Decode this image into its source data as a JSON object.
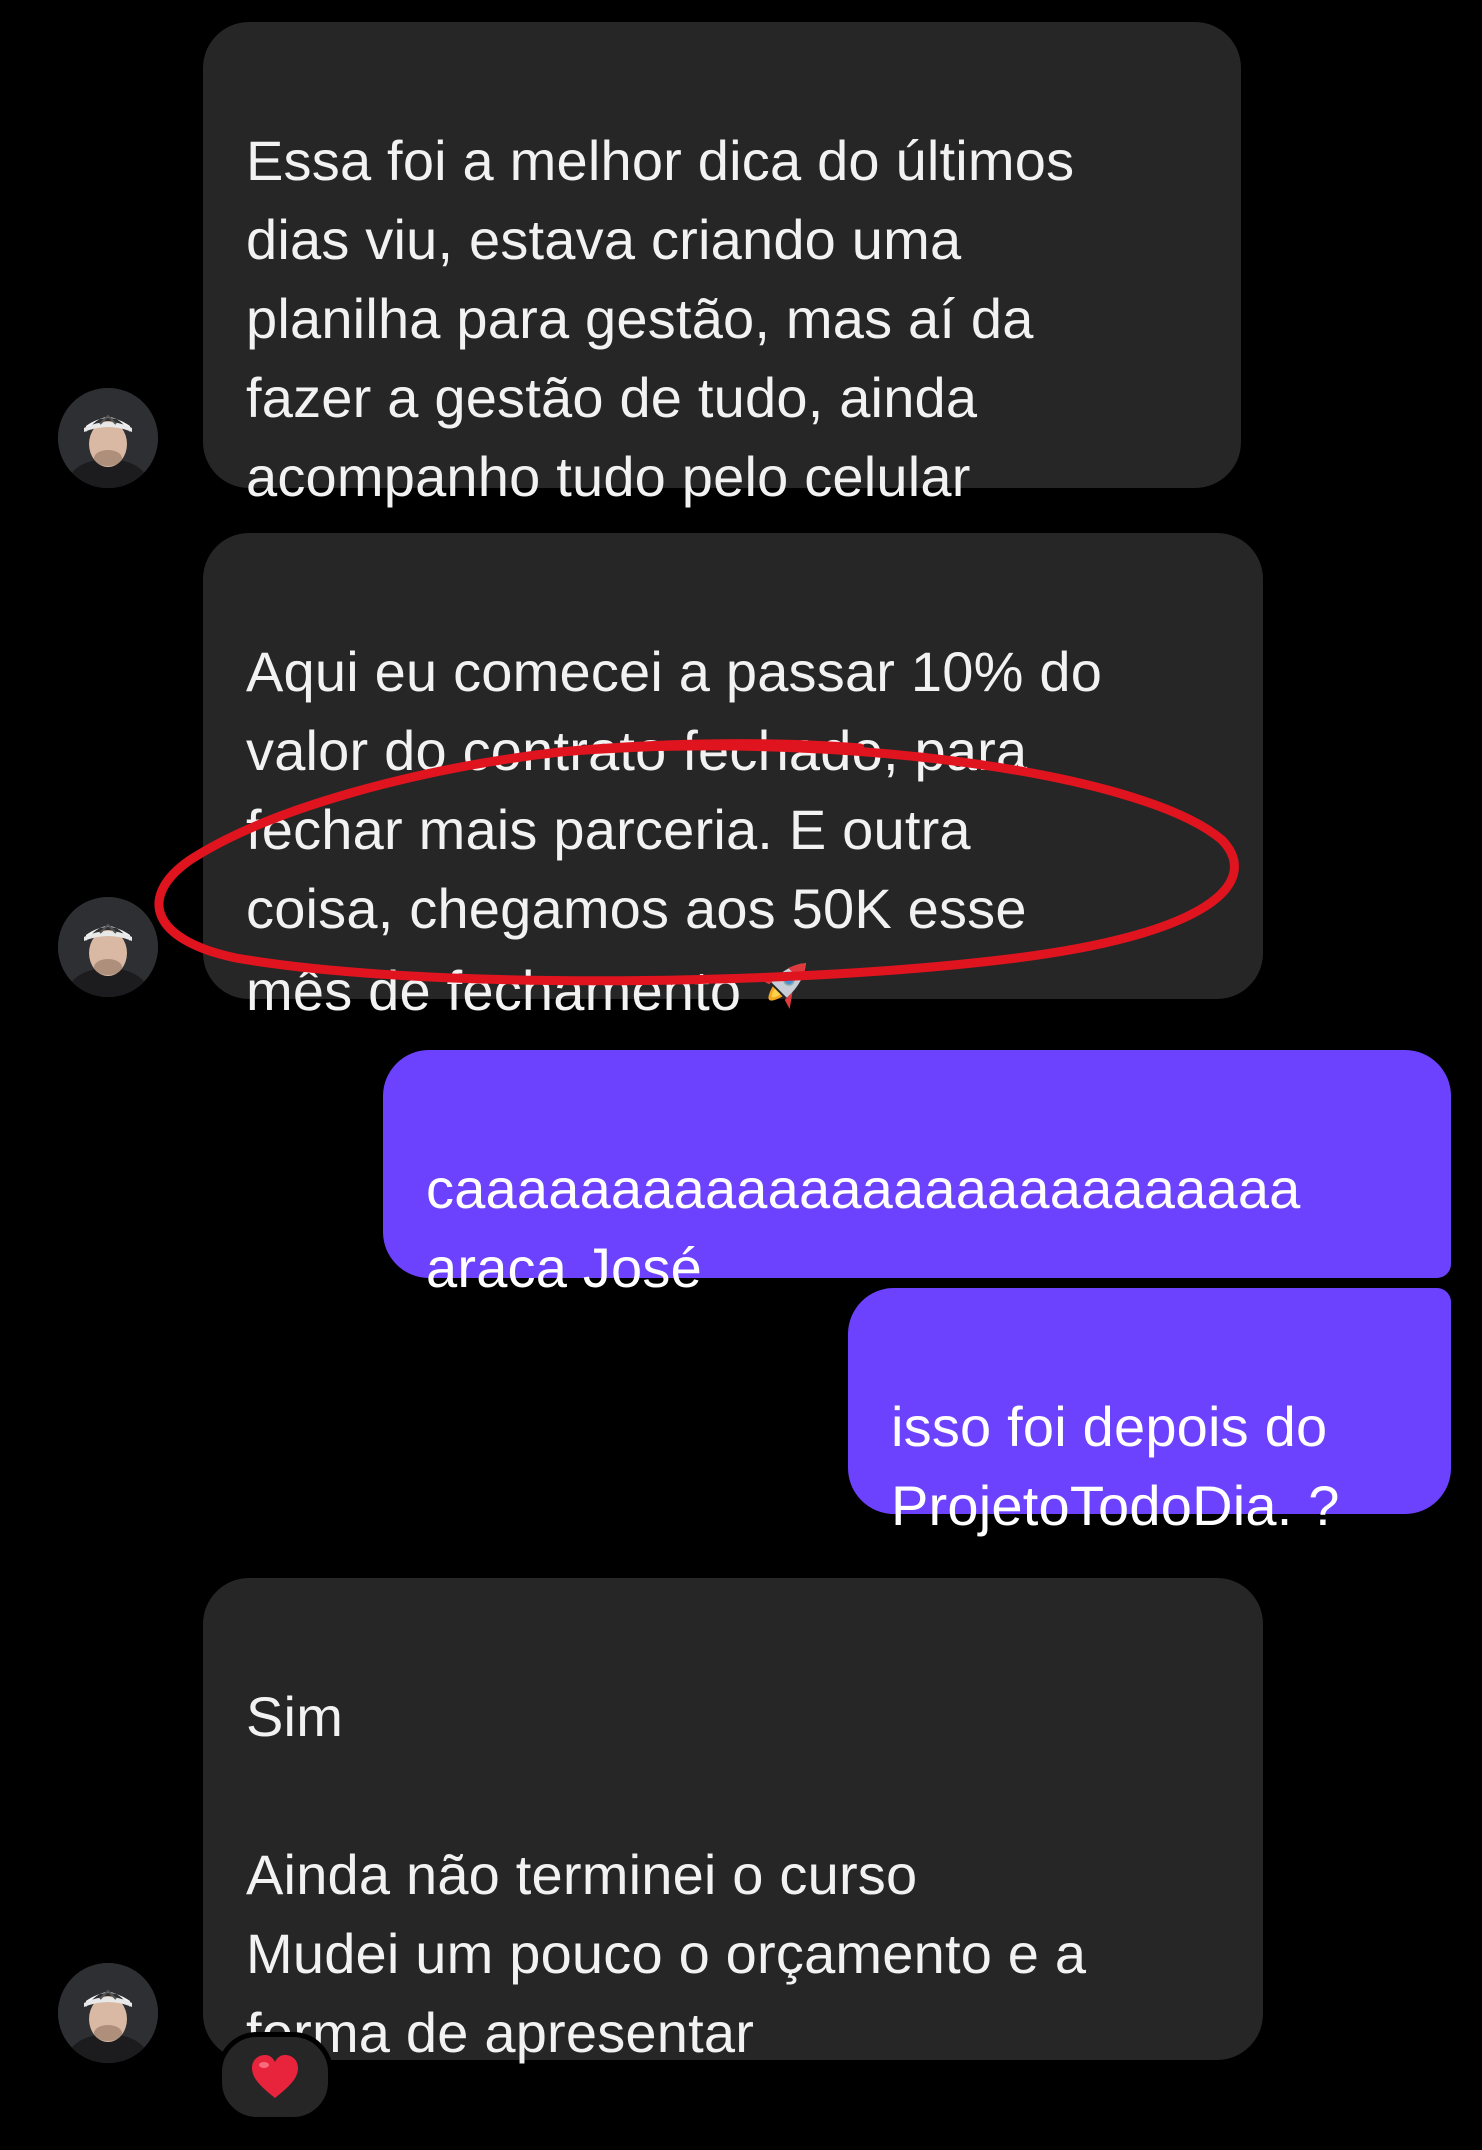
{
  "messages": [
    {
      "direction": "incoming",
      "text": "Essa foi a melhor dica do últimos\ndias viu, estava criando uma\nplanilha para gestão, mas aí da\nfazer a gestão de tudo, ainda\nacompanho tudo pelo celular"
    },
    {
      "direction": "incoming",
      "text": "Aqui eu comecei a passar 10% do\nvalor do contrato fechado, para\nfechar mais parceria. E outra\ncoisa, chegamos aos 50K esse\nmês de fechamento",
      "emoji": "rocket-icon"
    },
    {
      "direction": "outgoing",
      "text": "caaaaaaaaaaaaaaaaaaaaaaaaaaa\naraca José"
    },
    {
      "direction": "outgoing",
      "text": "isso foi depois do\nProjetoTodoDia. ?"
    },
    {
      "direction": "incoming",
      "text": "Sim\n\nAinda não terminei o curso\nMudei um pouco o orçamento e a\nforma de apresentar",
      "reaction": "heart-icon"
    }
  ],
  "colors": {
    "background": "#000000",
    "incoming_bubble": "#262626",
    "outgoing_bubble": "#6d42ff",
    "highlight": "#e0141e",
    "reaction_heart": "#e8243c"
  }
}
